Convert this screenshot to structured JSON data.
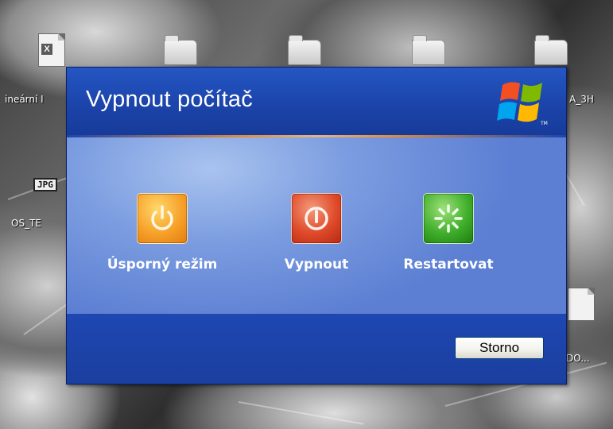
{
  "desktop": {
    "icons": [
      {
        "label": "ineární I"
      },
      {
        "label": "A_3H"
      },
      {
        "label": "OS_TE"
      },
      {
        "label": "DO..."
      }
    ],
    "jpg_badge": "JPG",
    "excel_glyph": "X"
  },
  "dialog": {
    "title": "Vypnout počítač",
    "actions": [
      {
        "label": "Úsporný režim",
        "icon": "standby-icon",
        "color": "#f7a12a"
      },
      {
        "label": "Vypnout",
        "icon": "power-off-icon",
        "color": "#df4a2a"
      },
      {
        "label": "Restartovat",
        "icon": "restart-icon",
        "color": "#3fae2a"
      }
    ],
    "cancel_label": "Storno",
    "logo_mark": "TM"
  },
  "colors": {
    "dialog_blue": "#1e3f9e",
    "body_blue": "#7c9de0"
  }
}
